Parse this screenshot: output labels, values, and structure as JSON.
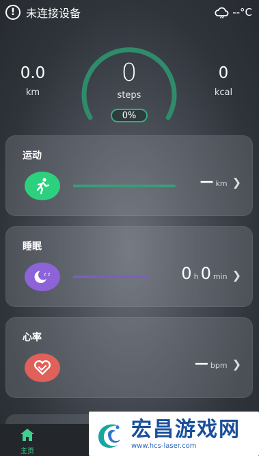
{
  "status": {
    "device_text": "未连接设备",
    "weather_text": "--°C"
  },
  "summary": {
    "distance": {
      "value": "0.0",
      "unit": "km"
    },
    "steps": {
      "value": "0",
      "unit": "steps",
      "progress_text": "0%",
      "progress": 0
    },
    "calories": {
      "value": "0",
      "unit": "kcal"
    }
  },
  "cards": {
    "exercise": {
      "title": "运动",
      "value": "—",
      "unit": "km",
      "icon": "running-person-icon",
      "color": "#2dd07f"
    },
    "sleep": {
      "title": "睡眠",
      "hours": "0",
      "hours_unit": "h",
      "minutes": "0",
      "minutes_unit": "min",
      "icon": "moon-stars-icon",
      "color": "#8d63d8"
    },
    "heart": {
      "title": "心率",
      "value": "—",
      "unit": "bpm",
      "icon": "heart-icon",
      "color": "#e0605a"
    }
  },
  "nav": {
    "home_label": "主页"
  },
  "watermark": {
    "title": "宏昌游戏网",
    "url": "www.hcs-laser.com"
  },
  "colors": {
    "accent": "#3ecf8e",
    "ring": "#2f8c6a"
  }
}
